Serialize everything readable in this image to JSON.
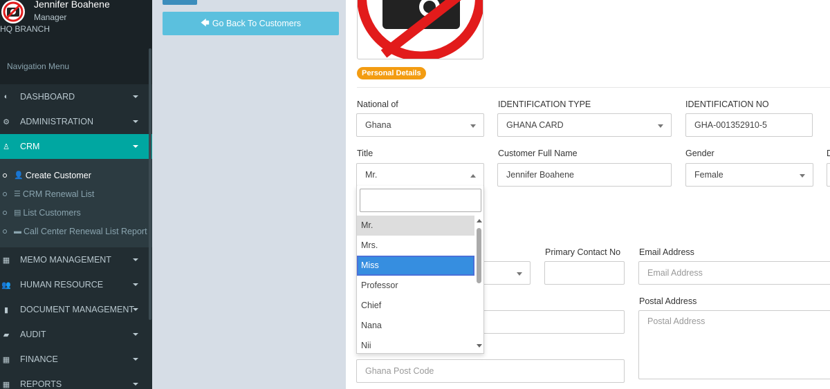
{
  "user": {
    "name": "Jennifer Boahene",
    "role": "Manager",
    "branch": "HQ BRANCH"
  },
  "nav": {
    "header": "Navigation Menu",
    "items": [
      {
        "label": "DASHBOARD",
        "icon": "adjust-icon"
      },
      {
        "label": "ADMINISTRATION",
        "icon": "gear-icon"
      },
      {
        "label": "CRM",
        "icon": "user-icon"
      },
      {
        "label": "MEMO MANAGEMENT",
        "icon": "memo-icon"
      },
      {
        "label": "HUMAN RESOURCE",
        "icon": "users-icon"
      },
      {
        "label": "DOCUMENT MANAGEMENT",
        "icon": "file-icon"
      },
      {
        "label": "AUDIT",
        "icon": "book-icon"
      },
      {
        "label": "FINANCE",
        "icon": "coins-icon"
      },
      {
        "label": "REPORTS",
        "icon": "report-icon"
      }
    ],
    "crm_sub": [
      {
        "label": "Create Customer",
        "icon": "user-plus-icon"
      },
      {
        "label": "CRM Renewal List",
        "icon": "list-icon"
      },
      {
        "label": "List Customers",
        "icon": "table-icon"
      },
      {
        "label": "Call Center Renewal List Report",
        "icon": "briefcase-icon"
      }
    ]
  },
  "buttons": {
    "back": "Go Back To Customers"
  },
  "section": {
    "badge": "Personal Details"
  },
  "form": {
    "national_of_label": "National of",
    "national_of_value": "Ghana",
    "id_type_label": "IDENTIFICATION TYPE",
    "id_type_value": "GHANA CARD",
    "id_no_label": "IDENTIFICATION NO",
    "id_no_value": "GHA-001352910-5",
    "title_label": "Title",
    "title_value": "Mr.",
    "full_name_label": "Customer Full Name",
    "full_name_value": "Jennifer Boahene",
    "gender_label": "Gender",
    "gender_value": "Female",
    "primary_contact_label": "Primary Contact No",
    "email_label": "Email Address",
    "email_placeholder": "Email Address",
    "postal_label": "Postal Address",
    "postal_placeholder": "Postal Address",
    "post_code_placeholder": "Ghana Post Code",
    "cut_label": "D"
  },
  "title_dropdown": {
    "options": [
      "Mr.",
      "Mrs.",
      "Miss",
      "Professor",
      "Chief",
      "Nana",
      "Nii"
    ],
    "selected": "Mr.",
    "highlighted": "Miss"
  },
  "colors": {
    "sidebar_bg": "#222d32",
    "active_nav": "#00a7a1",
    "back_button": "#5bc0de",
    "badge": "#f39c12",
    "highlight": "#368ee0"
  }
}
